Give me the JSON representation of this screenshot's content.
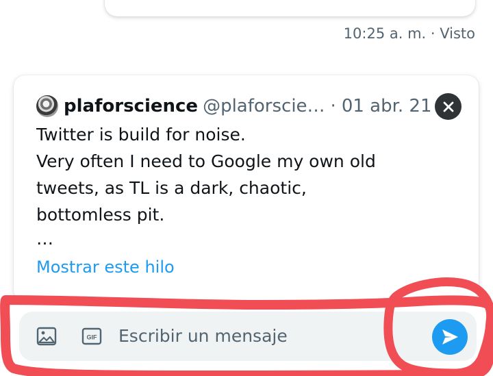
{
  "previous_message": {
    "status": "10:25 a. m. · Visto"
  },
  "quoted_tweet": {
    "display_name": "plaforscience",
    "handle": "@plaforscie…",
    "separator": "·",
    "date": "01 abr. 21",
    "lines": [
      "Twitter is build for noise.",
      "Very often I need to Google my own old",
      "tweets, as TL is a dark, chaotic,",
      "bottomless pit.",
      "…"
    ],
    "show_thread": "Mostrar este hilo",
    "avatar_icon": "user-avatar",
    "close_icon": "close-icon"
  },
  "composer": {
    "placeholder": "Escribir un mensaje",
    "image_icon": "image-icon",
    "gif_icon": "gif-icon",
    "gif_label": "GIF",
    "send_icon": "send-icon"
  },
  "colors": {
    "accent": "#1d9bf0",
    "text": "#0f1419",
    "secondary_text": "#536471",
    "composer_background": "#eff3f4",
    "annotation": "#f04d55"
  }
}
